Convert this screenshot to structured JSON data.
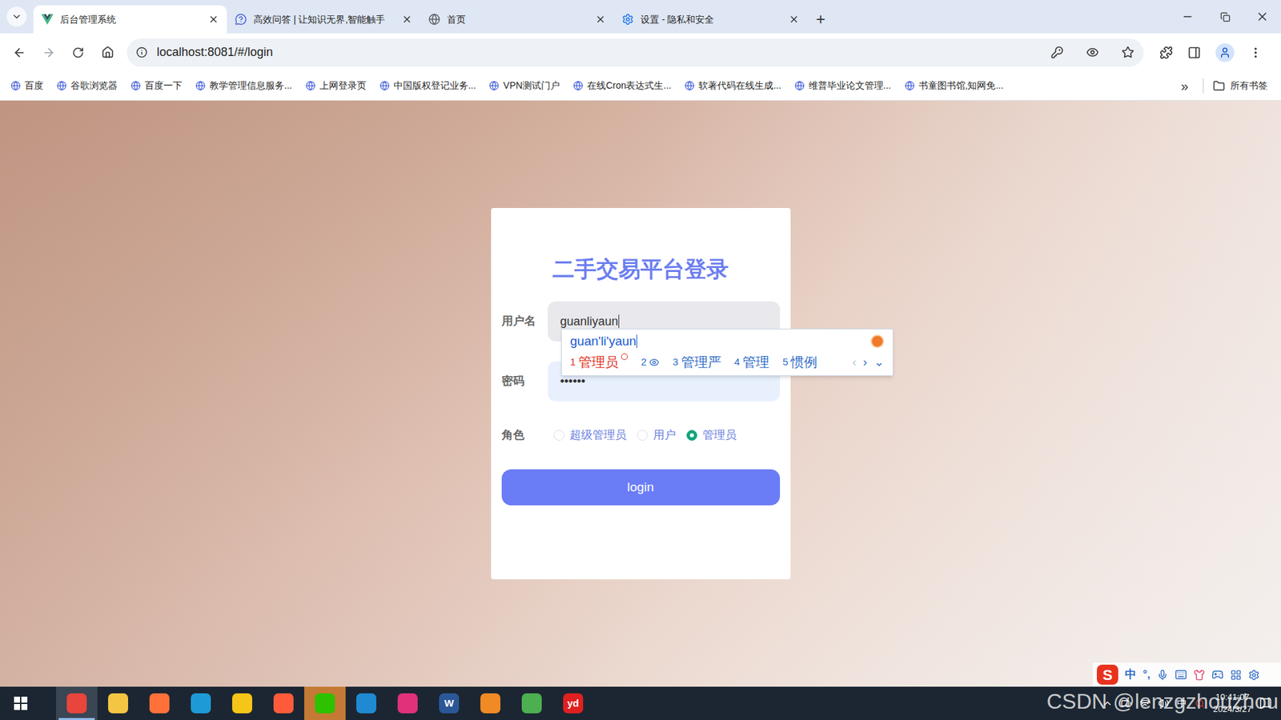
{
  "browser": {
    "tabs": [
      {
        "title": "后台管理系统",
        "selected": true
      },
      {
        "title": "高效问答 | 让知识无界,智能触手",
        "selected": false
      },
      {
        "title": "首页",
        "selected": false
      },
      {
        "title": "设置 - 隐私和安全",
        "selected": false
      }
    ],
    "new_tab": "+",
    "address": "localhost:8081/#/login",
    "bookmarks": [
      "百度",
      "谷歌浏览器",
      "百度一下",
      "教学管理信息服务...",
      "上网登录页",
      "中国版权登记业务...",
      "VPN测试门户",
      "在线Cron表达式生...",
      "软著代码在线生成...",
      "维普毕业论文管理...",
      "书童图书馆,知网免..."
    ],
    "bookmarks_more": "»",
    "all_bookmarks": "所有书签"
  },
  "login": {
    "title": "二手交易平台登录",
    "fields": [
      {
        "label": "用户名",
        "value": "guanliyaun",
        "kind": "text",
        "focused": true
      },
      {
        "label": "密码",
        "value": "••••••",
        "kind": "password",
        "focused": false
      }
    ],
    "role": {
      "label": "角色",
      "options": [
        {
          "label": "超级管理员",
          "selected": false
        },
        {
          "label": "用户",
          "selected": false
        },
        {
          "label": "管理员",
          "selected": true
        }
      ]
    },
    "button": "login"
  },
  "ime": {
    "composition": "guan'li'yaun",
    "candidates": [
      {
        "index": "1",
        "text": "管理员",
        "kind": "word",
        "selected": true
      },
      {
        "index": "2",
        "text": "",
        "kind": "icon",
        "selected": false
      },
      {
        "index": "3",
        "text": "管理严",
        "kind": "word",
        "selected": false
      },
      {
        "index": "4",
        "text": "管理",
        "kind": "word",
        "selected": false
      },
      {
        "index": "5",
        "text": "惯例",
        "kind": "word",
        "selected": false
      }
    ],
    "nav": [
      "‹",
      "›",
      "⌄"
    ]
  },
  "ime_status": {
    "logo": "S",
    "mode": "中",
    "punct": "°,"
  },
  "taskbar": {
    "apps": [
      {
        "name": "chrome",
        "glyph": "",
        "active": true,
        "attention": false
      },
      {
        "name": "file-explorer",
        "glyph": "",
        "active": false,
        "attention": false
      },
      {
        "name": "firefox",
        "glyph": "",
        "active": false,
        "attention": false
      },
      {
        "name": "edge",
        "glyph": "",
        "active": false,
        "attention": false
      },
      {
        "name": "app-yellow",
        "glyph": "",
        "active": false,
        "attention": false
      },
      {
        "name": "firefox-dev",
        "glyph": "",
        "active": false,
        "attention": false
      },
      {
        "name": "wechat",
        "glyph": "",
        "active": false,
        "attention": true
      },
      {
        "name": "vscode",
        "glyph": "",
        "active": false,
        "attention": false
      },
      {
        "name": "jetbrains",
        "glyph": "",
        "active": false,
        "attention": false
      },
      {
        "name": "word",
        "glyph": "W",
        "active": false,
        "attention": false
      },
      {
        "name": "search-app",
        "glyph": "",
        "active": false,
        "attention": false
      },
      {
        "name": "app-colorful",
        "glyph": "",
        "active": false,
        "attention": false
      },
      {
        "name": "youdao",
        "glyph": "yd",
        "active": false,
        "attention": false
      }
    ],
    "tray_lang": "中",
    "time": "10:41:07",
    "date": "2024/3/27"
  },
  "watermark": "CSDN @lenzgzhouzhou"
}
